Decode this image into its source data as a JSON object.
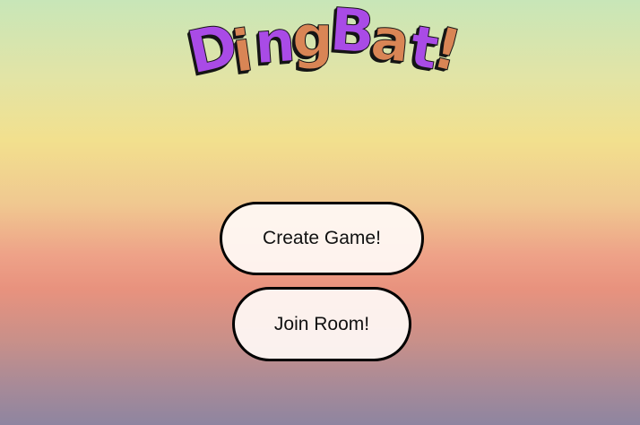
{
  "logo": {
    "text": "DingBat!",
    "letters": [
      {
        "char": "D",
        "color": "#a94be6"
      },
      {
        "char": "i",
        "color": "#d98555"
      },
      {
        "char": "n",
        "color": "#a94be6"
      },
      {
        "char": "g",
        "color": "#d98555"
      },
      {
        "char": "B",
        "color": "#a94be6"
      },
      {
        "char": "a",
        "color": "#d98555"
      },
      {
        "char": "t",
        "color": "#a94be6"
      },
      {
        "char": "!",
        "color": "#d98555"
      }
    ]
  },
  "menu": {
    "create_label": "Create Game!",
    "join_label": "Join Room!"
  },
  "colors": {
    "purple": "#a94be6",
    "orange": "#d98555",
    "button_bg": "#fdf3ee",
    "button_border": "#000000"
  }
}
